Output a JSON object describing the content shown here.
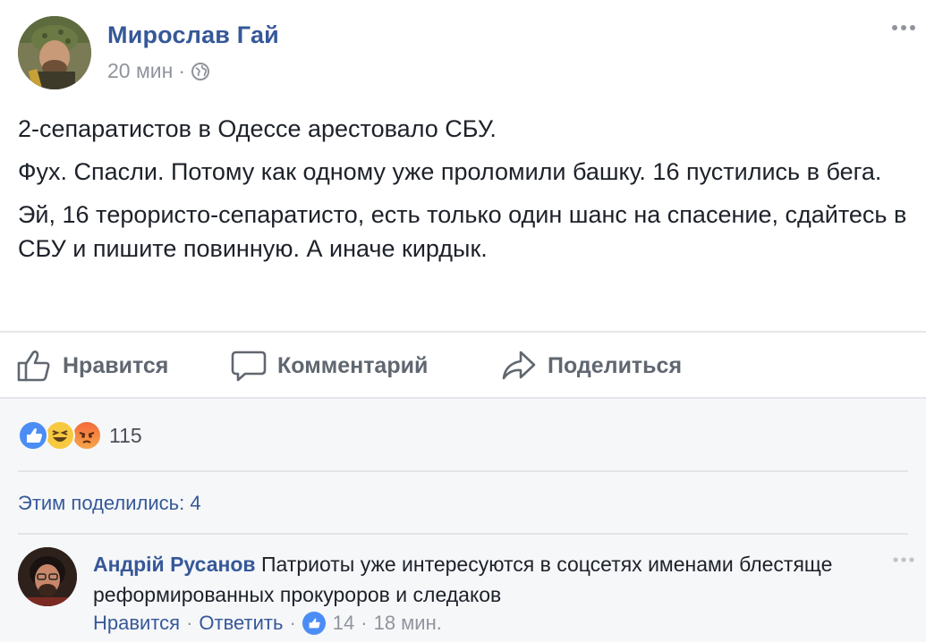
{
  "post": {
    "author": "Мирослав Гай",
    "time": "20 мин",
    "time_separator": "·",
    "privacy_icon": "globe-icon",
    "paragraphs": [
      "2-сепаратистов в Одессе арестовало СБУ.",
      "Фух. Спасли. Потому как одному уже проломили башку. 16 пустились в бега.",
      "Эй, 16 тeрористо-сепаратисто, есть только один шанс на спасение, сдайтесь в СБУ и пишите повинную. А иначе кирдык."
    ]
  },
  "actions": {
    "like": "Нравится",
    "comment": "Комментарий",
    "share": "Поделиться"
  },
  "reactions": {
    "icons": [
      "like-reaction",
      "haha-reaction",
      "angry-reaction"
    ],
    "count": "115"
  },
  "shares": {
    "label": "Этим поделились: 4"
  },
  "comment": {
    "author": "Андрій Русанов",
    "text": "Патриоты уже интересуются в соцсетях именами блестяще реформированных прокуроров и следаков",
    "like_label": "Нравится",
    "reply_label": "Ответить",
    "likes": "14",
    "time": "18 мин.",
    "separator": "·"
  },
  "colors": {
    "link": "#365899",
    "meta": "#90949c",
    "text": "#1d2129",
    "like_blue": "#4c8df5",
    "background_lower": "#f6f7f9"
  }
}
